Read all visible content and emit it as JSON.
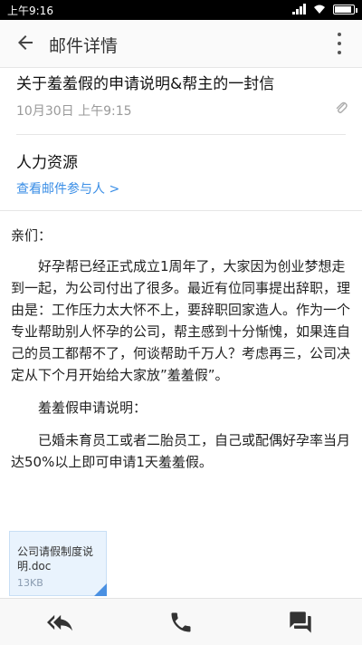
{
  "statusbar": {
    "time": "上午9:16"
  },
  "appbar": {
    "title": "邮件详情"
  },
  "email": {
    "subject": "关于羞羞假的申请说明&帮主的一封信",
    "date": "10月30日 上午9:15",
    "sender": "人力资源",
    "participants_link": "查看邮件参与人 >",
    "greeting": "亲们：",
    "paragraphs": [
      "好孕帮已经正式成立1周年了，大家因为创业梦想走到一起，为公司付出了很多。最近有位同事提出辞职，理由是：工作压力太大怀不上，要辞职回家造人。作为一个专业帮助别人怀孕的公司，帮主感到十分惭愧，如果连自己的员工都帮不了，何谈帮助千万人？考虑再三，公司决定从下个月开始给大家放”羞羞假”。",
      "羞羞假申请说明：",
      "已婚未育员工或者二胎员工，自己或配偶好孕率当月达50%以上即可申请1天羞羞假。"
    ]
  },
  "attachment": {
    "name": "公司请假制度说明.doc",
    "size": "13KB"
  },
  "icons": {
    "back": "arrow-left",
    "more": "vertical-dots",
    "attachment": "paperclip",
    "reply_all": "reply-all",
    "call": "phone",
    "chat": "chat-bubbles"
  },
  "colors": {
    "link": "#3a8ee6",
    "attachment_bg": "#e9f3fd",
    "attachment_accent": "#4a90e2"
  }
}
